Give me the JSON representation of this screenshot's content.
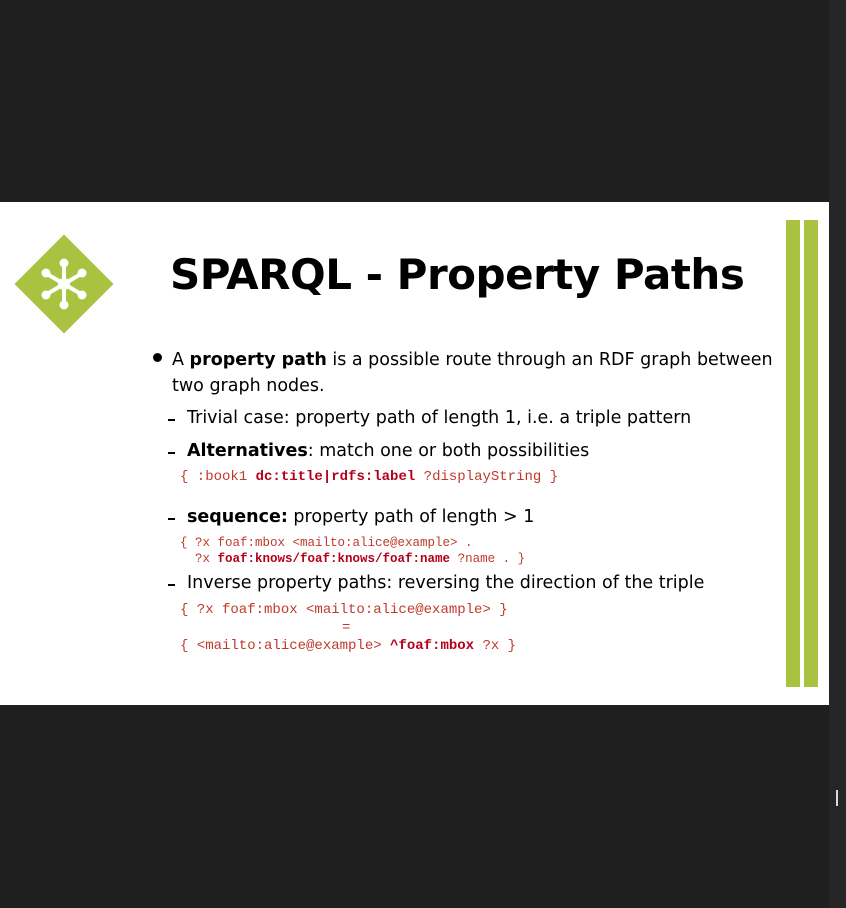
{
  "slide": {
    "title": "SPARQL - Property Paths",
    "bullet": {
      "prefix": "A ",
      "bold": "property path",
      "rest_line1": " is a possible route through an RDF graph between",
      "line2": "two graph nodes."
    },
    "trivial": "Trivial case: property path of length 1, i.e. a triple pattern",
    "alternatives": {
      "bold": "Alternatives",
      "rest": ": match one or both possibilities",
      "code_pre": "{ :book1 ",
      "code_bold": "dc:title|rdfs:label",
      "code_post": " ?displayString }"
    },
    "sequence": {
      "bold": "sequence:",
      "rest": " property path of length > 1",
      "code_line1": "{ ?x foaf:mbox <mailto:alice@example> .",
      "code_line2_pre": "  ?x ",
      "code_line2_bold": "foaf:knows/foaf:knows/foaf:name",
      "code_line2_post": " ?name . }"
    },
    "inverse": {
      "text": "Inverse property paths: reversing the direction of the triple",
      "code_line1": "{ ?x foaf:mbox <mailto:alice@example> }",
      "code_eq": "=",
      "code_line3_pre": "{ <mailto:alice@example> ",
      "code_line3_bold": "^foaf:mbox",
      "code_line3_post": " ?x }"
    }
  },
  "colors": {
    "accent": "#a9c23f",
    "code": "#c0392b",
    "background": "#1f1f1f"
  },
  "icons": {
    "logo": "network-hub-icon"
  }
}
